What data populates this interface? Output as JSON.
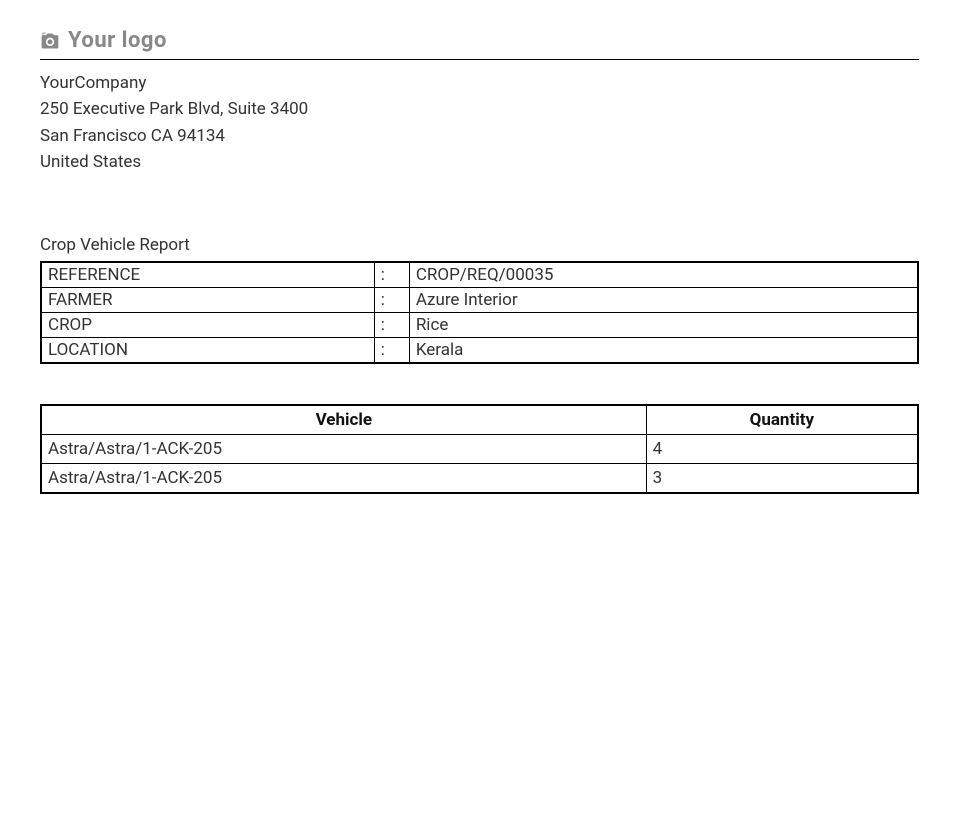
{
  "header": {
    "logo_label": "Your logo"
  },
  "company": {
    "name": "YourCompany",
    "street": "250 Executive Park Blvd, Suite 3400",
    "city_line": "San Francisco CA 94134",
    "country": "United States"
  },
  "report": {
    "title": "Crop Vehicle Report",
    "info": [
      {
        "label": "REFERENCE",
        "value": "CROP/REQ/00035"
      },
      {
        "label": "FARMER",
        "value": "Azure Interior"
      },
      {
        "label": "CROP",
        "value": "Rice"
      },
      {
        "label": "LOCATION",
        "value": "Kerala"
      }
    ],
    "columns": {
      "vehicle": "Vehicle",
      "quantity": "Quantity"
    },
    "rows": [
      {
        "vehicle": "Astra/Astra/1-ACK-205",
        "quantity": "4"
      },
      {
        "vehicle": "Astra/Astra/1-ACK-205",
        "quantity": "3"
      }
    ]
  }
}
